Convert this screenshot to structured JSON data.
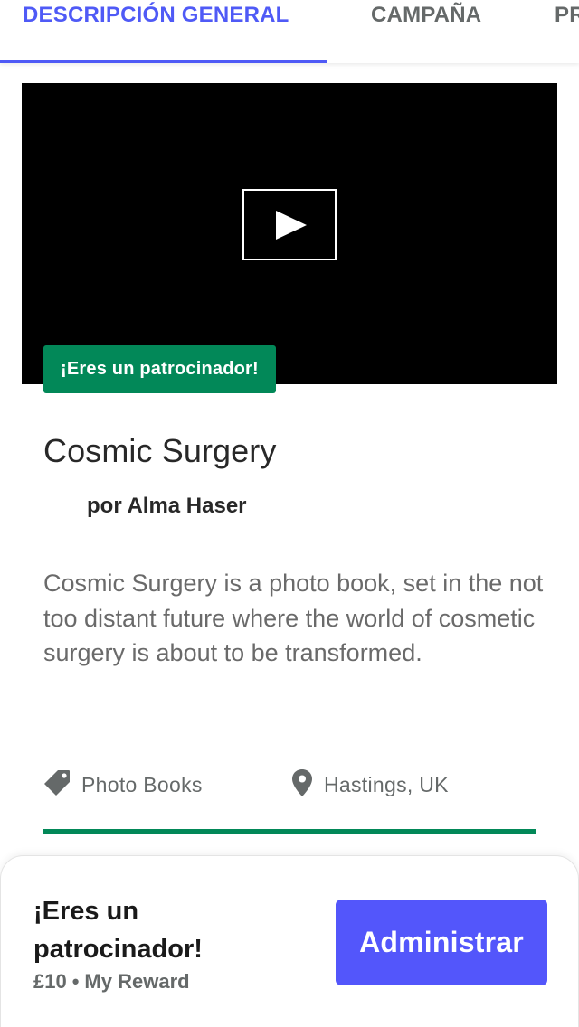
{
  "tabs": [
    {
      "label": "DESCRIPCIÓN GENERAL",
      "active": true
    },
    {
      "label": "CAMPAÑA",
      "active": false
    },
    {
      "label": "PR",
      "active": false
    }
  ],
  "video": {
    "play_icon": "play-icon"
  },
  "backer_badge": "¡Eres un patrocinador!",
  "project": {
    "title": "Cosmic Surgery",
    "creator": "por Alma Haser",
    "blurb": "Cosmic Surgery is a photo book, set in the not too distant future where the world of cosmetic surgery is about to be transformed.",
    "category": "Photo Books",
    "category_icon": "tag-icon",
    "location": "Hastings, UK",
    "location_icon": "location-pin-icon",
    "funding_progress": 1.0
  },
  "bottom_sheet": {
    "title": "¡Eres un patrocinador!",
    "amount": "£10",
    "separator": "•",
    "reward": "My Reward",
    "manage_button": "Administrar"
  },
  "colors": {
    "accent": "#4f5af6",
    "button": "#5356fb",
    "success_green": "#028858"
  }
}
